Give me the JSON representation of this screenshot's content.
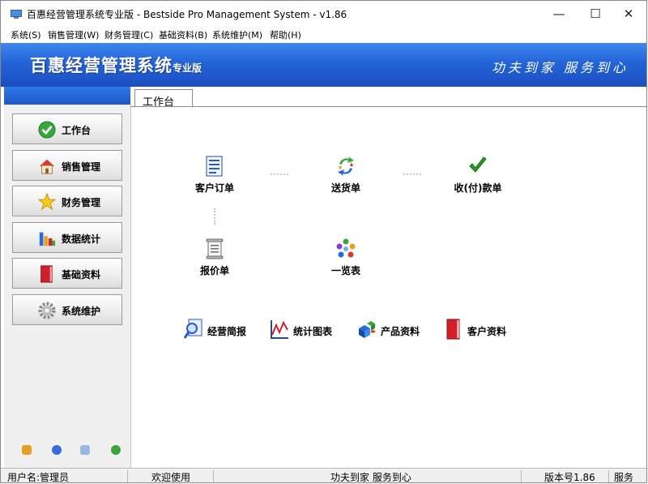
{
  "window": {
    "title": "百惠经营管理系统专业版 - Bestside Pro Management System - v1.86",
    "minimize_glyph": "—",
    "maximize_glyph": "☐",
    "close_glyph": "✕"
  },
  "menu": [
    "系统(S)",
    "销售管理(W)",
    "财务管理(C)",
    "基础资料(B)",
    "系统维护(M)",
    "帮助(H)"
  ],
  "banner": {
    "brand": "百惠经营管理系统",
    "edition": "专业版",
    "slogan": "功夫到家 服务到心"
  },
  "nav": [
    {
      "label": "工作台",
      "icon": "check-circle-icon"
    },
    {
      "label": "销售管理",
      "icon": "house-icon"
    },
    {
      "label": "财务管理",
      "icon": "star-icon"
    },
    {
      "label": "数据统计",
      "icon": "bar-chart-icon"
    },
    {
      "label": "基础资料",
      "icon": "red-book-icon"
    },
    {
      "label": "系统维护",
      "icon": "gear-icon"
    }
  ],
  "tab": {
    "label": "工作台"
  },
  "flow": {
    "order": {
      "label": "客户订单",
      "icon": "order-document-icon"
    },
    "delivery": {
      "label": "送货单",
      "icon": "recycle-arrows-icon"
    },
    "receipt": {
      "label": "收(付)款单",
      "icon": "green-check-icon"
    },
    "quote": {
      "label": "报价单",
      "icon": "scroll-document-icon"
    },
    "overview": {
      "label": "一览表",
      "icon": "circle-dots-icon"
    }
  },
  "quick": [
    {
      "label": "经营简报",
      "icon": "magnifier-report-icon"
    },
    {
      "label": "统计图表",
      "icon": "line-chart-icon"
    },
    {
      "label": "产品资料",
      "icon": "product-cubes-icon"
    },
    {
      "label": "客户资料",
      "icon": "customer-book-icon"
    }
  ],
  "status": {
    "user": "用户名:管理员",
    "welcome": "欢迎使用",
    "slogan": "功夫到家 服务到心",
    "version": "版本号1.86",
    "service": "服务"
  },
  "colors": {
    "banner": "#2364d6",
    "accent_green": "#3aa53a"
  }
}
